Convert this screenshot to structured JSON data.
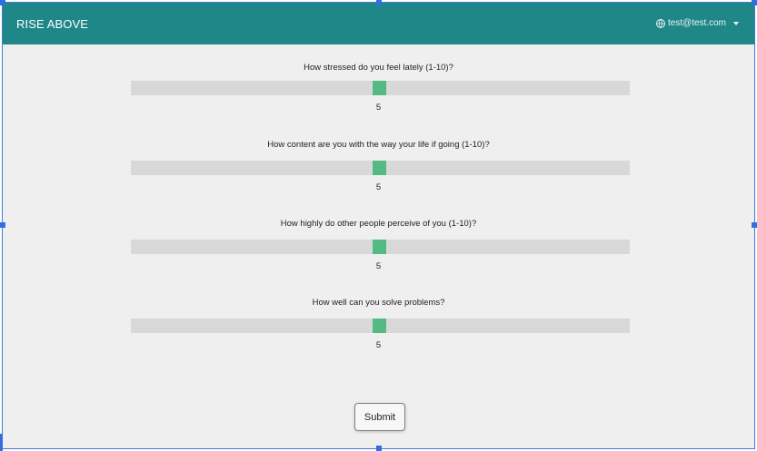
{
  "navbar": {
    "brand": "RISE ABOVE",
    "user_email": "test@test.com",
    "user_icon": "globe-icon",
    "menu_icon": "caret-down-icon",
    "background_color": "#1f8787"
  },
  "questions": [
    {
      "label": "How stressed do you feel lately (1-10)?",
      "value": "5"
    },
    {
      "label": "How content are you with the way your life if going (1-10)?",
      "value": "5"
    },
    {
      "label": "How highly do other people perceive of you (1-10)?",
      "value": "5"
    },
    {
      "label": "How well can you solve problems?",
      "value": "5"
    }
  ],
  "slider": {
    "min": 1,
    "max": 10,
    "thumb_color": "#53ba84",
    "track_color": "#d8d8d8"
  },
  "form": {
    "submit_label": "Submit"
  }
}
